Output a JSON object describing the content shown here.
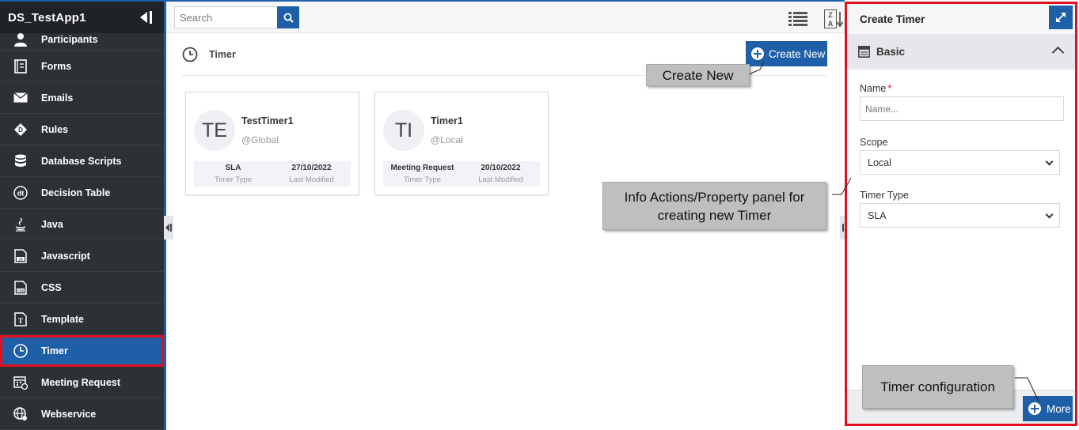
{
  "app": {
    "title": "DS_TestApp1"
  },
  "sidebar": {
    "items": [
      {
        "label": "Participants",
        "icon": "user-icon"
      },
      {
        "label": "Forms",
        "icon": "form-icon"
      },
      {
        "label": "Emails",
        "icon": "envelope-icon"
      },
      {
        "label": "Rules",
        "icon": "rules-diamond-icon"
      },
      {
        "label": "Database Scripts",
        "icon": "database-icon"
      },
      {
        "label": "Decision Table",
        "icon": "decision-table-icon"
      },
      {
        "label": "Java",
        "icon": "java-icon"
      },
      {
        "label": "Javascript",
        "icon": "javascript-file-icon"
      },
      {
        "label": "CSS",
        "icon": "css-file-icon"
      },
      {
        "label": "Template",
        "icon": "template-icon"
      },
      {
        "label": "Timer",
        "icon": "clock-icon",
        "active": true
      },
      {
        "label": "Meeting Request",
        "icon": "calendar-icon"
      },
      {
        "label": "Webservice",
        "icon": "globe-gear-icon"
      }
    ]
  },
  "toolbar": {
    "search_placeholder": "Search"
  },
  "content": {
    "heading": "Timer",
    "create_new_label": "Create New",
    "cards": [
      {
        "initials": "TE",
        "name": "TestTimer1",
        "scope": "@Global",
        "type_value": "SLA",
        "type_label": "Timer Type",
        "modified_value": "27/10/2022",
        "modified_label": "Last Modified"
      },
      {
        "initials": "TI",
        "name": "Timer1",
        "scope": "@Local",
        "type_value": "Meeting Request",
        "type_label": "Timer Type",
        "modified_value": "20/10/2022",
        "modified_label": "Last Modified"
      }
    ]
  },
  "callouts": {
    "create_new": "Create New",
    "panel_info_line1": "Info Actions/Property panel for",
    "panel_info_line2": "creating new Timer",
    "timer_config": "Timer configuration"
  },
  "panel": {
    "title": "Create Timer",
    "section": "Basic",
    "name_label": "Name",
    "name_required": "*",
    "name_placeholder": "Name...",
    "scope_label": "Scope",
    "scope_value": "Local",
    "timer_type_label": "Timer Type",
    "timer_type_value": "SLA",
    "more_label": "More"
  },
  "colors": {
    "accent": "#1f5fa8",
    "highlight": "#e0101e",
    "sidebar_bg": "#2d3035"
  }
}
